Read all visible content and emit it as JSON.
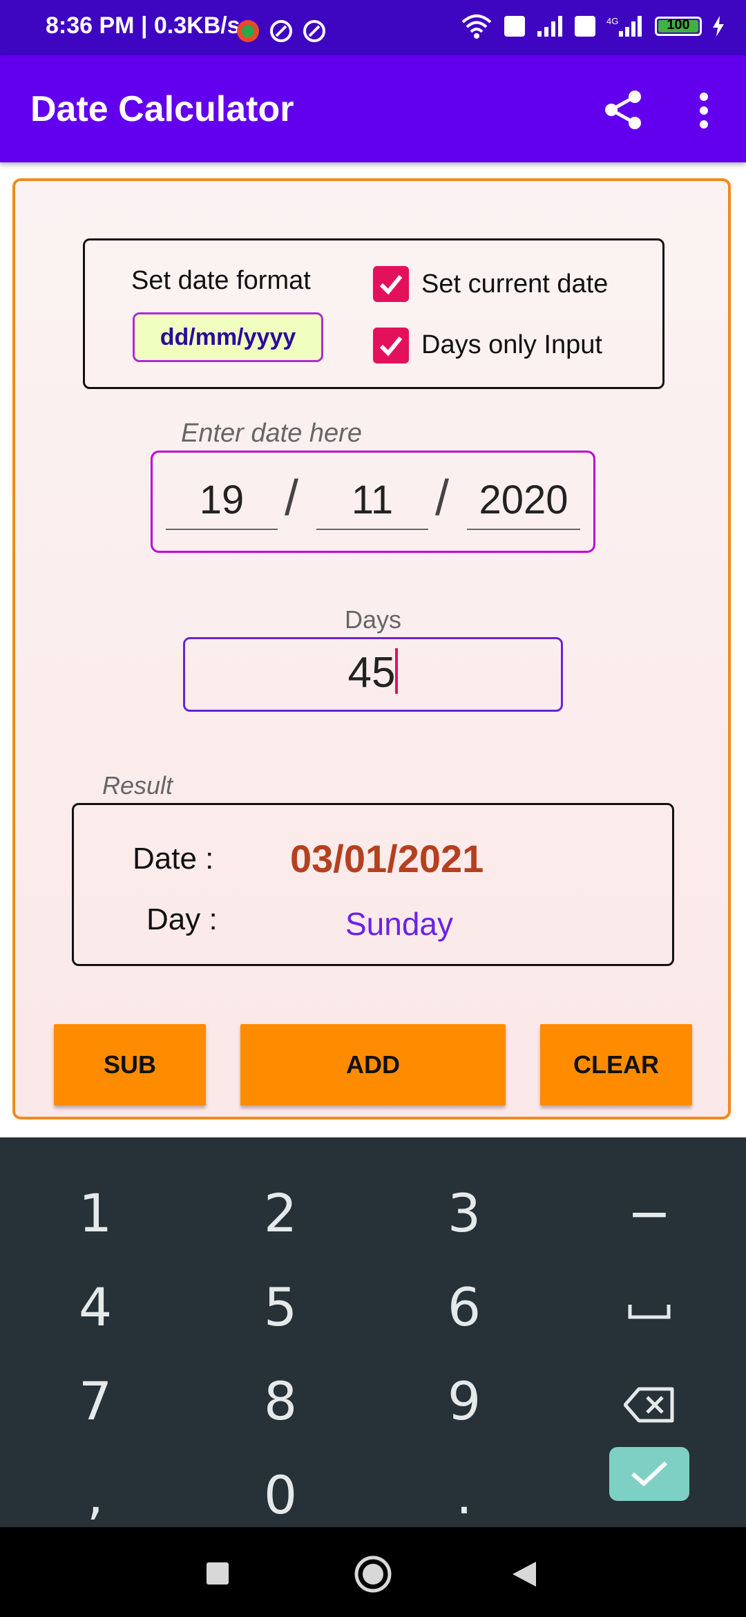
{
  "status_bar": {
    "time": "8:36 PM | 0.3KB/s",
    "battery": "100"
  },
  "app_bar": {
    "title": "Date Calculator",
    "share_icon": "share-icon",
    "menu_icon": "more-vert-icon"
  },
  "format_section": {
    "label": "Set date format",
    "format_value": "dd/mm/yyyy",
    "set_current_date_label": "Set current date",
    "set_current_date_checked": true,
    "days_only_label": "Days only Input",
    "days_only_checked": true
  },
  "date_input": {
    "label": "Enter date here",
    "day": "19",
    "month": "11",
    "year": "2020",
    "separator": "/"
  },
  "days_input": {
    "label": "Days",
    "value": "45"
  },
  "result": {
    "label": "Result",
    "date_label": "Date :",
    "date_value": "03/01/2021",
    "day_label": "Day :",
    "day_value": "Sunday"
  },
  "buttons": {
    "sub": "SUB",
    "add": "ADD",
    "clear": "CLEAR"
  },
  "keyboard": {
    "keys": [
      "1",
      "2",
      "3",
      "−",
      "4",
      "5",
      "6",
      "␣",
      "7",
      "8",
      "9",
      "⌫",
      ",",
      "0",
      ".",
      "✓"
    ]
  },
  "colors": {
    "status_bar": "#3f06c2",
    "app_bar": "#6200ee",
    "card_border": "#f08a1c",
    "button": "#ff8c00",
    "checkbox": "#e3115c",
    "result_date": "#b5401f",
    "result_day": "#6a22e8",
    "keyboard_bg": "#263238",
    "enter_key": "#7fd0c4"
  }
}
